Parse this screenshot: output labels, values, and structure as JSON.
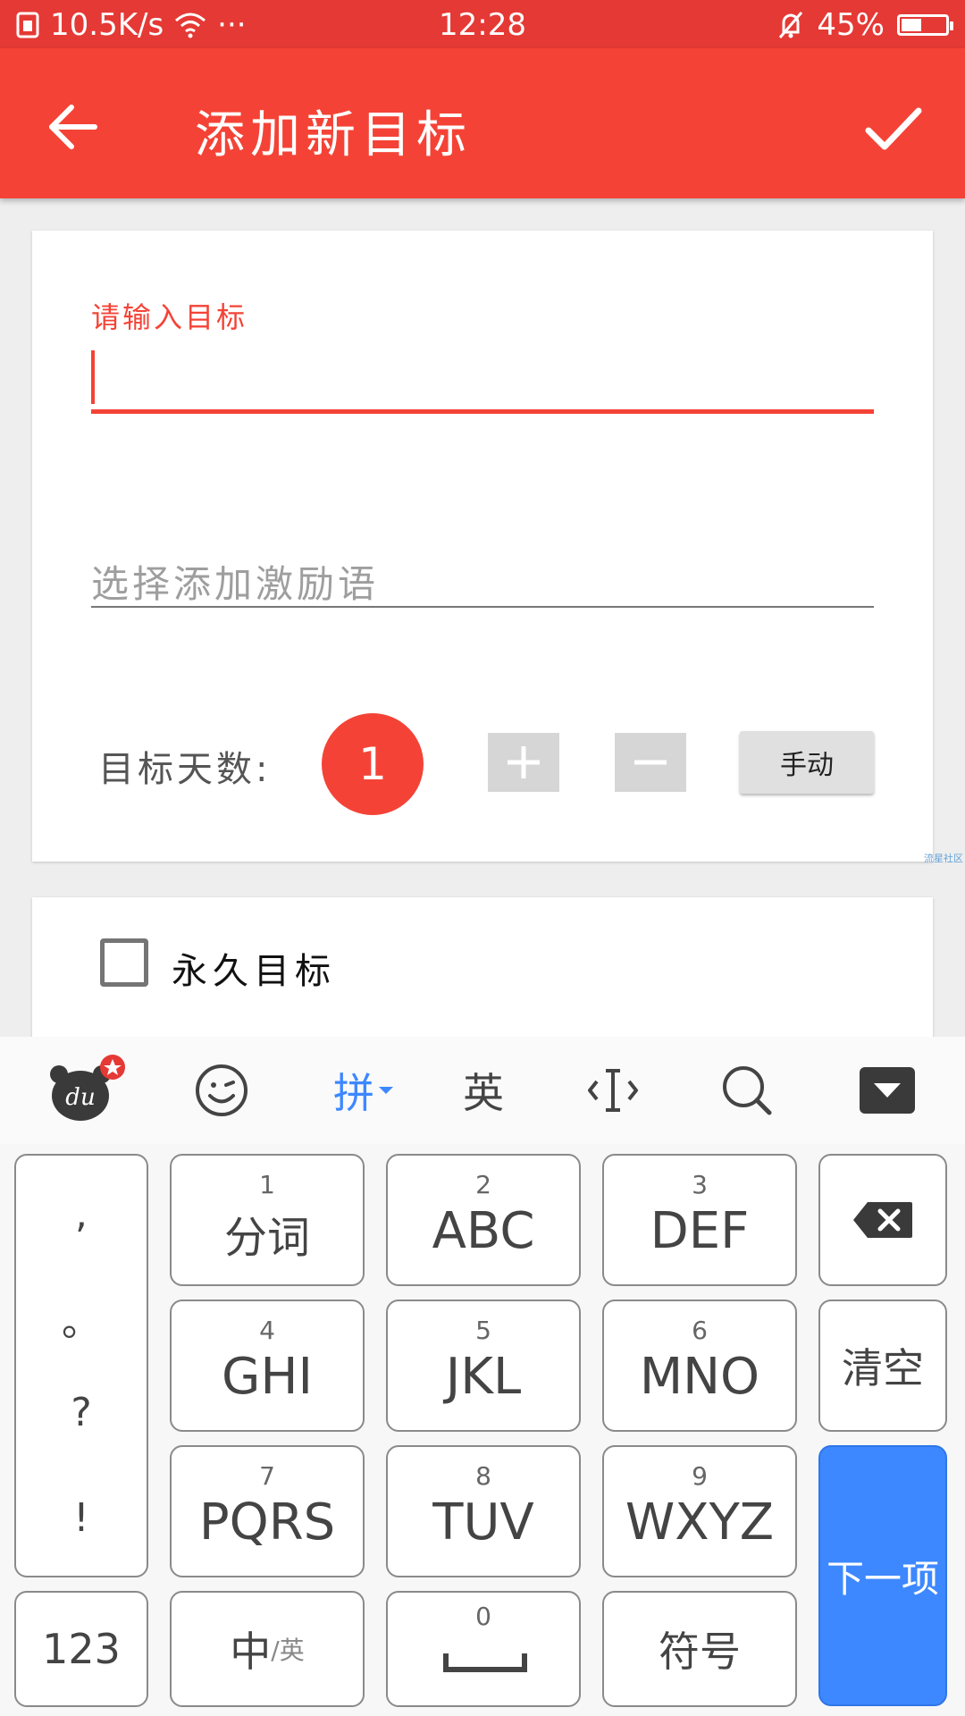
{
  "status_bar": {
    "speed": "10.5K/s",
    "dots": "···",
    "time": "12:28",
    "battery": "45%",
    "battery_level": 0.45
  },
  "app_bar": {
    "title": "添加新目标",
    "back_icon": "arrow-left-icon",
    "confirm_icon": "check-icon"
  },
  "form": {
    "goal_label": "请输入目标",
    "goal_value": "",
    "motto_placeholder": "选择添加激励语",
    "days_label": "目标天数:",
    "days_value": "1",
    "plus_label": "+",
    "minus_label": "−",
    "manual_label": "手动",
    "permanent_label": "永久目标",
    "watermark": "流星社区"
  },
  "keyboard": {
    "toolbar": {
      "pinyin": "拼",
      "english": "英"
    },
    "keys": {
      "k1": {
        "num": "1",
        "label": "分词"
      },
      "k2": {
        "num": "2",
        "label": "ABC"
      },
      "k3": {
        "num": "3",
        "label": "DEF"
      },
      "k4": {
        "num": "4",
        "label": "GHI"
      },
      "k5": {
        "num": "5",
        "label": "JKL"
      },
      "k6": {
        "num": "6",
        "label": "MNO"
      },
      "k7": {
        "num": "7",
        "label": "PQRS"
      },
      "k8": {
        "num": "8",
        "label": "TUV"
      },
      "k9": {
        "num": "9",
        "label": "WXYZ"
      },
      "k0": {
        "num": "0"
      },
      "clear": "清空",
      "next": "下一项",
      "num_mode": "123",
      "lang_main": "中",
      "lang_sub": "/英",
      "symbols": "符号"
    },
    "punctuation": [
      ",",
      "。",
      "?",
      "!"
    ]
  },
  "colors": {
    "primary": "#f44336",
    "status": "#e53935",
    "accent_blue": "#3d88ff"
  }
}
